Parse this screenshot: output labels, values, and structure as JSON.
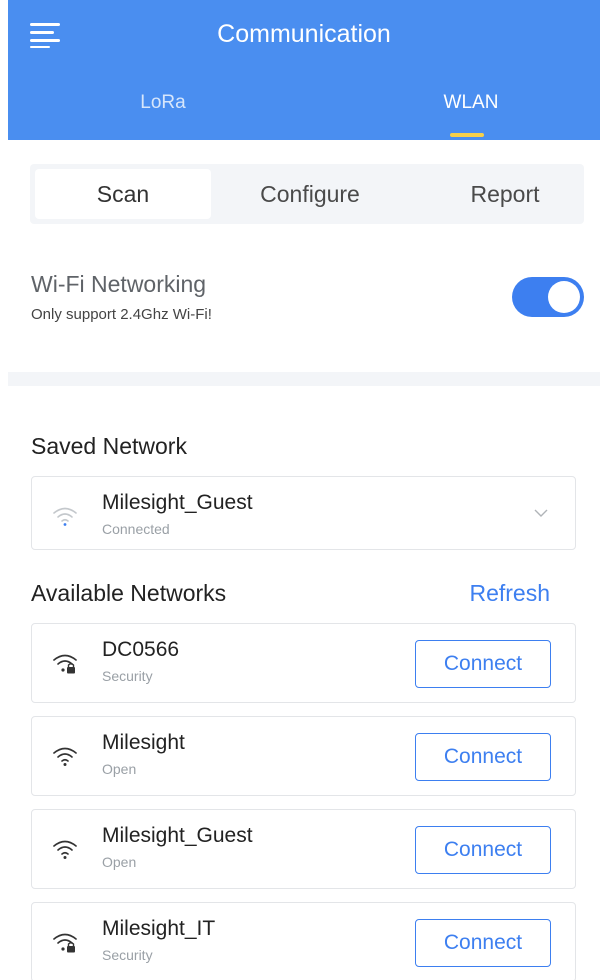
{
  "header": {
    "title": "Communication",
    "tabs": [
      {
        "label": "LoRa",
        "active": false
      },
      {
        "label": "WLAN",
        "active": true
      }
    ],
    "background_color": "#4a8ef0",
    "indicator_color": "#f7d04a"
  },
  "segmented": {
    "scan": "Scan",
    "configure": "Configure",
    "report": "Report",
    "selected": "Scan"
  },
  "wifi": {
    "title": "Wi-Fi Networking",
    "subtitle": "Only support 2.4Ghz Wi-Fi!",
    "enabled": true,
    "toggle_color": "#3d7ff0"
  },
  "saved": {
    "title": "Saved Network",
    "network": {
      "name": "Milesight_Guest",
      "status": "Connected",
      "icon": "wifi-icon"
    }
  },
  "available": {
    "title": "Available Networks",
    "refresh_label": "Refresh",
    "connect_label": "Connect",
    "networks": [
      {
        "name": "DC0566",
        "security": "Security",
        "icon": "wifi-lock-icon"
      },
      {
        "name": "Milesight",
        "security": "Open",
        "icon": "wifi-icon"
      },
      {
        "name": "Milesight_Guest",
        "security": "Open",
        "icon": "wifi-icon"
      },
      {
        "name": "Milesight_IT",
        "security": "Security",
        "icon": "wifi-lock-icon"
      }
    ]
  }
}
